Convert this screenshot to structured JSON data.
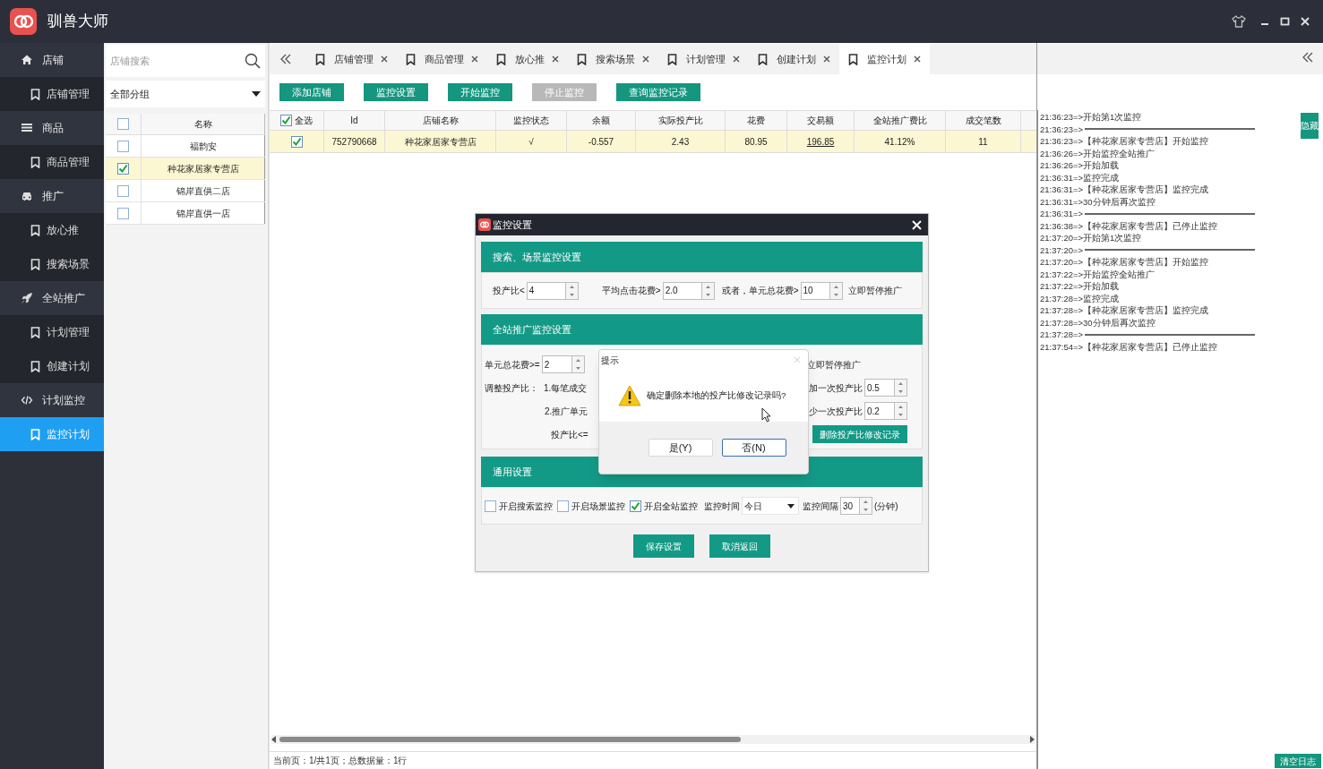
{
  "app": {
    "title": "驯兽大师"
  },
  "sidebar": {
    "items": [
      {
        "label": "店铺",
        "children": [
          {
            "label": "店铺管理",
            "selected": false
          }
        ]
      },
      {
        "label": "商品",
        "children": [
          {
            "label": "商品管理",
            "selected": false
          }
        ]
      },
      {
        "label": "推广",
        "children": [
          {
            "label": "放心推",
            "selected": false
          },
          {
            "label": "搜索场景",
            "selected": false
          }
        ]
      },
      {
        "label": "全站推广",
        "children": [
          {
            "label": "计划管理",
            "selected": false
          },
          {
            "label": "创建计划",
            "selected": false
          }
        ]
      },
      {
        "label": "计划监控",
        "children": [
          {
            "label": "监控计划",
            "selected": true
          }
        ]
      }
    ]
  },
  "store_panel": {
    "search": {
      "placeholder": "店铺搜索"
    },
    "group_select": {
      "value": "全部分组"
    },
    "header_checked": false,
    "column": "名称",
    "rows": [
      {
        "name": "福韵安",
        "checked": false,
        "selected": false
      },
      {
        "name": "种花家居家专营店",
        "checked": true,
        "selected": true
      },
      {
        "name": "锦岸直供二店",
        "checked": false,
        "selected": false
      },
      {
        "name": "锦岸直供一店",
        "checked": false,
        "selected": false
      }
    ]
  },
  "tabs": [
    {
      "label": "店铺管理",
      "selected": false
    },
    {
      "label": "商品管理",
      "selected": false
    },
    {
      "label": "放心推",
      "selected": false
    },
    {
      "label": "搜索场景",
      "selected": false
    },
    {
      "label": "计划管理",
      "selected": false
    },
    {
      "label": "创建计划",
      "selected": false
    },
    {
      "label": "监控计划",
      "selected": true
    }
  ],
  "toolbar": [
    {
      "label": "添加店铺",
      "disabled": false
    },
    {
      "label": "监控设置",
      "disabled": false
    },
    {
      "label": "开始监控",
      "disabled": false
    },
    {
      "label": "停止监控",
      "disabled": true
    },
    {
      "label": "查询监控记录",
      "disabled": false
    }
  ],
  "table": {
    "select_all": {
      "label": "全选",
      "checked": true
    },
    "columns": [
      {
        "label": "Id",
        "kind": "text"
      },
      {
        "label": "店铺名称",
        "kind": "text"
      },
      {
        "label": "监控状态",
        "kind": "text"
      },
      {
        "label": "余额",
        "kind": "text"
      },
      {
        "label": "实际投产比",
        "kind": "text"
      },
      {
        "label": "花费",
        "kind": "text"
      },
      {
        "label": "交易额",
        "kind": "link"
      },
      {
        "label": "全站推广费比",
        "kind": "text"
      },
      {
        "label": "成交笔数",
        "kind": "text"
      }
    ],
    "rows": [
      {
        "checked": true,
        "selected": true,
        "cells": [
          "752790668",
          "种花家居家专营店",
          "√",
          "-0.557",
          "2.43",
          "80.95",
          "196.85",
          "41.12%",
          "11"
        ]
      }
    ]
  },
  "status_bar": "当前页：1/共1页；总数据量：1行",
  "log": {
    "hide_button": "隐藏",
    "clear_button": "清空日志",
    "entries": [
      {
        "kind": "line",
        "text": "21:36:23=>开始第1次监控"
      },
      {
        "kind": "rule",
        "text": "21:36:23=>"
      },
      {
        "kind": "line",
        "text": "21:36:23=>【种花家居家专营店】开始监控"
      },
      {
        "kind": "line",
        "text": "21:36:26=>开始监控全站推广"
      },
      {
        "kind": "line",
        "text": "21:36:26=>开始加载"
      },
      {
        "kind": "line",
        "text": "21:36:31=>监控完成"
      },
      {
        "kind": "line",
        "text": "21:36:31=>【种花家居家专营店】监控完成"
      },
      {
        "kind": "line",
        "text": "21:36:31=>30分钟后再次监控"
      },
      {
        "kind": "rule",
        "text": "21:36:31=>"
      },
      {
        "kind": "line",
        "text": "21:36:38=>【种花家居家专营店】已停止监控"
      },
      {
        "kind": "line",
        "text": "21:37:20=>开始第1次监控"
      },
      {
        "kind": "rule",
        "text": "21:37:20=>"
      },
      {
        "kind": "line",
        "text": "21:37:20=>【种花家居家专营店】开始监控"
      },
      {
        "kind": "line",
        "text": "21:37:22=>开始监控全站推广"
      },
      {
        "kind": "line",
        "text": "21:37:22=>开始加载"
      },
      {
        "kind": "line",
        "text": "21:37:28=>监控完成"
      },
      {
        "kind": "line",
        "text": "21:37:28=>【种花家居家专营店】监控完成"
      },
      {
        "kind": "line",
        "text": "21:37:28=>30分钟后再次监控"
      },
      {
        "kind": "rule",
        "text": "21:37:28=>"
      },
      {
        "kind": "line",
        "text": "21:37:54=>【种花家居家专营店】已停止监控"
      }
    ]
  },
  "settings_dialog": {
    "title": "监控设置",
    "search_section": {
      "title": "搜索、场景监控设置",
      "roi_label": "投产比<",
      "roi": "4",
      "cpc_label": "平均点击花费>",
      "cpc": "2.0",
      "cost_label": "或者，单元总花费>",
      "cost": "10",
      "action": "立即暂停推广"
    },
    "site_section": {
      "title": "全站推广监控设置",
      "cost_label": "单元总花费>=",
      "cost": "2",
      "action": "立即暂停推广",
      "adjust_label": "调整投产比：",
      "rule_1": "1.每笔成交",
      "rule_2": "2.推广单元",
      "roi_label": "投产比<=",
      "increase_label": "加一次投产比",
      "increase": "0.5",
      "decrease_label": "少一次投产比",
      "decrease": "0.2",
      "delete_button": "删除投产比修改记录"
    },
    "general_section": {
      "title": "通用设置",
      "options": [
        {
          "label": "开启搜索监控",
          "checked": false
        },
        {
          "label": "开启场景监控",
          "checked": false
        },
        {
          "label": "开启全站监控",
          "checked": true
        }
      ],
      "time_label": "监控时间",
      "time": "今日",
      "interval_label": "监控间隔",
      "interval": "30",
      "unit": "(分钟)"
    },
    "buttons": [
      "保存设置",
      "取消返回"
    ]
  },
  "prompt": {
    "title": "提示",
    "message": "确定删除本地的投产比修改记录吗?",
    "buttons": [
      {
        "label": "是(Y)",
        "focused": false
      },
      {
        "label": "否(N)",
        "focused": true
      }
    ]
  }
}
